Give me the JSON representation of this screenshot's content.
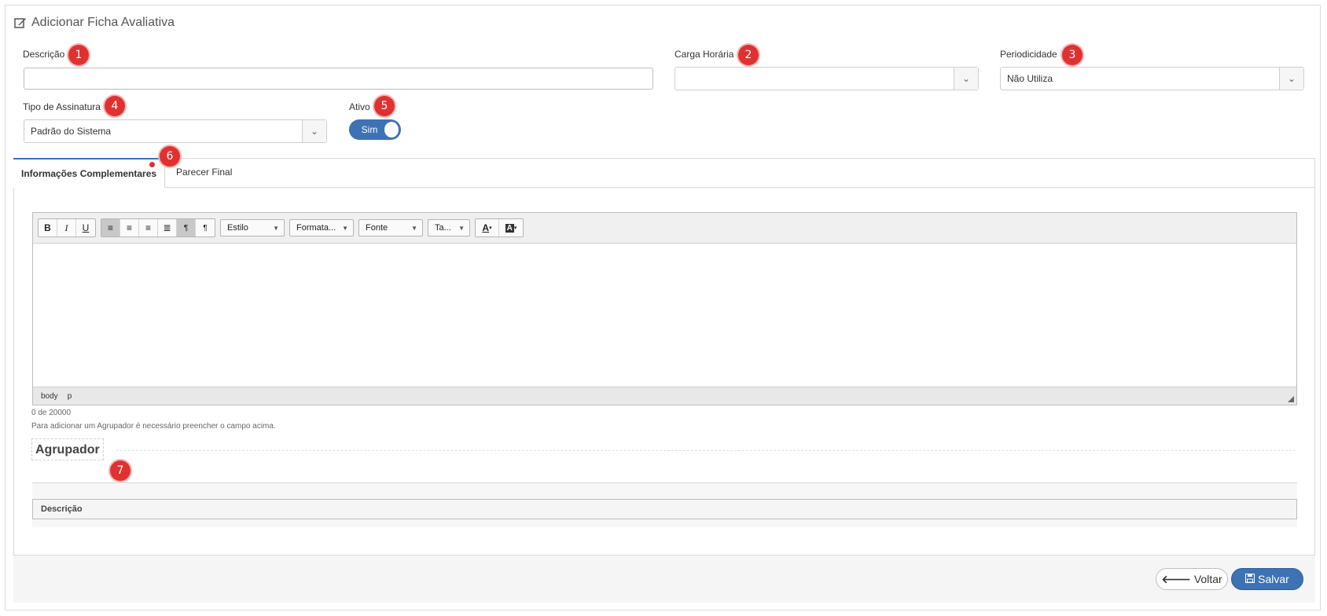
{
  "page": {
    "title": "Adicionar Ficha Avaliativa",
    "title_icon": "edit-icon"
  },
  "fields": {
    "descricao": {
      "label": "Descrição",
      "value": "",
      "badge": "1"
    },
    "carga_horaria": {
      "label": "Carga Horária",
      "value": "",
      "badge": "2"
    },
    "periodicidade": {
      "label": "Periodicidade",
      "value": "Não Utiliza",
      "badge": "3"
    },
    "tipo_assinatura": {
      "label": "Tipo de Assinatura",
      "value": "Padrão do Sistema",
      "badge": "4"
    },
    "ativo": {
      "label": "Ativo",
      "toggle_text": "Sim",
      "badge": "5"
    }
  },
  "tabs": [
    {
      "label": "Informações Complementares",
      "active": true,
      "badge": "6"
    },
    {
      "label": "Parecer Final",
      "active": false
    }
  ],
  "editor": {
    "dropdowns": {
      "estilo": "Estilo",
      "formata": "Formata...",
      "fonte": "Fonte",
      "tamanho": "Ta..."
    },
    "status_path": [
      "body",
      "p"
    ],
    "char_count": "0 de 20000",
    "hint": "Para adicionar um Agrupador é necessário preencher o campo acima."
  },
  "agrupador": {
    "title": "Agrupador",
    "badge": "7",
    "table_header": "Descrição"
  },
  "actions": {
    "back_label": "Voltar",
    "save_label": "Salvar"
  },
  "colors": {
    "primary": "#3d72b4",
    "badge": "#e03131"
  }
}
